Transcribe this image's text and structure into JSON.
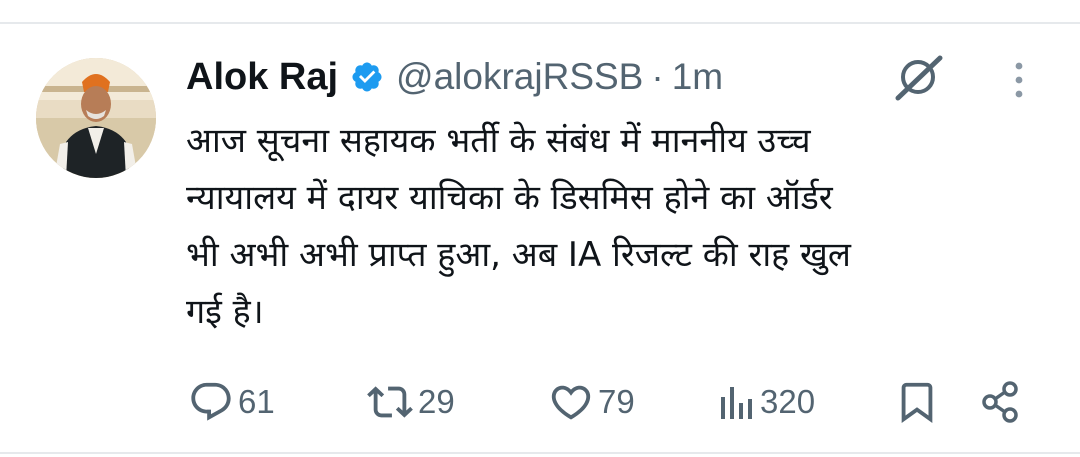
{
  "tweet": {
    "author_name": "Alok Raj",
    "handle": "@alokrajRSSB",
    "separator": "·",
    "time_ago": "1m",
    "text_lines": [
      "आज सूचना सहायक भर्ती के संबंध में माननीय उच्च",
      "न्यायालय में दायर याचिका के डिसमिस होने का ऑर्डर",
      "भी अभी अभी प्राप्त हुआ, अब IA रिजल्ट की राह खुल",
      "गई है।"
    ]
  },
  "stats": {
    "replies": "61",
    "reposts": "29",
    "likes": "79",
    "views": "320"
  },
  "colors": {
    "text_primary": "#0f1419",
    "text_secondary": "#536471",
    "verified_blue": "#1d9bf0",
    "divider": "#e6e9ec"
  },
  "icons": [
    "verified-badge-icon",
    "grok-icon",
    "more-icon",
    "reply-icon",
    "repost-icon",
    "like-icon",
    "views-icon",
    "bookmark-icon",
    "share-icon"
  ]
}
